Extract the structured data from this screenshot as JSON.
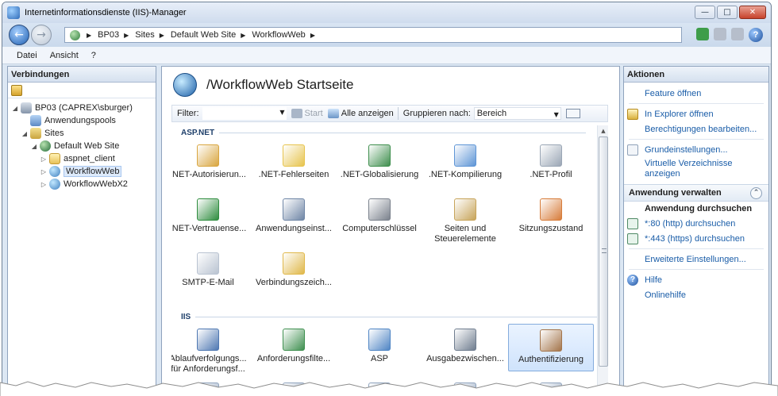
{
  "window": {
    "title": "Internetinformationsdienste (IIS)-Manager",
    "controls": {
      "minimize": "—",
      "maximize": "□",
      "close": "✕"
    }
  },
  "address": {
    "breadcrumbs": [
      "BP03",
      "Sites",
      "Default Web Site",
      "WorkflowWeb"
    ]
  },
  "menu": {
    "items": [
      "Datei",
      "Ansicht",
      "?"
    ]
  },
  "left": {
    "header": "Verbindungen",
    "tree": [
      {
        "label": "BP03 (CAPREX\\sburger)",
        "level": 0,
        "expander": "◢",
        "icon": "server-icon"
      },
      {
        "label": "Anwendungspools",
        "level": 1,
        "expander": "",
        "icon": "app-pool-icon"
      },
      {
        "label": "Sites",
        "level": 1,
        "expander": "◢",
        "icon": "sites-icon"
      },
      {
        "label": "Default Web Site",
        "level": 2,
        "expander": "◢",
        "icon": "globe-icon"
      },
      {
        "label": "aspnet_client",
        "level": 3,
        "expander": "▷",
        "icon": "folder-icon"
      },
      {
        "label": "WorkflowWeb",
        "level": 3,
        "expander": "▷",
        "icon": "web-app-icon",
        "selected": true
      },
      {
        "label": "WorkflowWebX2",
        "level": 3,
        "expander": "▷",
        "icon": "web-app-icon"
      }
    ]
  },
  "center": {
    "title": "/WorkflowWeb Startseite",
    "filter": {
      "label": "Filter:",
      "start_label": "Start",
      "show_all_label": "Alle anzeigen",
      "group_label": "Gruppieren nach:",
      "group_value": "Bereich"
    },
    "groups": [
      {
        "name": "ASP.NET",
        "features": [
          {
            "label": ".NET-Autorisierun...",
            "icon": "authorization-icon",
            "color": "#d9a640"
          },
          {
            "label": ".NET-Fehlerseiten",
            "icon": "error-page-icon",
            "color": "#e7c44e"
          },
          {
            "label": ".NET-Globalisierung",
            "icon": "globe-icon",
            "color": "#3f8f4e"
          },
          {
            "label": ".NET-Kompilierung",
            "icon": "compilation-icon",
            "color": "#5e95d6"
          },
          {
            "label": ".NET-Profil",
            "icon": "profile-icon",
            "color": "#9aa6b5"
          },
          {
            "label": ".NET-Vertrauense...",
            "icon": "trust-icon",
            "color": "#2f8d3f"
          },
          {
            "label": "Anwendungseinst...",
            "icon": "app-settings-icon",
            "color": "#6f86a6"
          },
          {
            "label": "Computerschlüssel",
            "icon": "machine-key-icon",
            "color": "#7a818c"
          },
          {
            "label": "Seiten und Steuerelemente",
            "icon": "pages-controls-icon",
            "color": "#c7a45a"
          },
          {
            "label": "Sitzungszustand",
            "icon": "session-state-icon",
            "color": "#d77c3a"
          },
          {
            "label": "SMTP-E-Mail",
            "icon": "smtp-icon",
            "color": "#b9c3d1"
          },
          {
            "label": "Verbindungszeich...",
            "icon": "connection-strings-icon",
            "color": "#e0b84a"
          }
        ]
      },
      {
        "name": "IIS",
        "features": [
          {
            "label": "Ablaufverfolgungs... für Anforderungsf...",
            "icon": "failed-request-icon",
            "color": "#4f78b2"
          },
          {
            "label": "Anforderungsfilte...",
            "icon": "request-filtering-icon",
            "color": "#3f9050"
          },
          {
            "label": "ASP",
            "icon": "asp-icon",
            "color": "#4f85c4"
          },
          {
            "label": "Ausgabezwischen...",
            "icon": "output-caching-icon",
            "color": "#6f7d8f"
          },
          {
            "label": "Authentifizierung",
            "icon": "authentication-icon",
            "color": "#a3744a",
            "selected": true
          }
        ]
      }
    ],
    "next_row_icons": [
      "authorization-rules-icon",
      "cgi-icon",
      "compression-icon",
      "error-pages-icon",
      "handler-mappings-icon"
    ]
  },
  "right": {
    "header": "Aktionen",
    "actions_top": [
      {
        "label": "Feature öffnen",
        "icon": ""
      },
      {
        "label": "In Explorer öffnen",
        "icon": "explorer-icon"
      },
      {
        "label": "Berechtigungen bearbeiten...",
        "icon": ""
      },
      {
        "label": "Grundeinstellungen...",
        "icon": "basic-settings-icon"
      },
      {
        "label": "Virtuelle Verzeichnisse anzeigen",
        "icon": ""
      }
    ],
    "manage_header": "Anwendung verwalten",
    "browse_header": "Anwendung durchsuchen",
    "browse_links": [
      "*:80 (http) durchsuchen",
      "*:443 (https) durchsuchen"
    ],
    "advanced": "Erweiterte Einstellungen...",
    "help": "Hilfe",
    "online_help": "Onlinehilfe"
  }
}
